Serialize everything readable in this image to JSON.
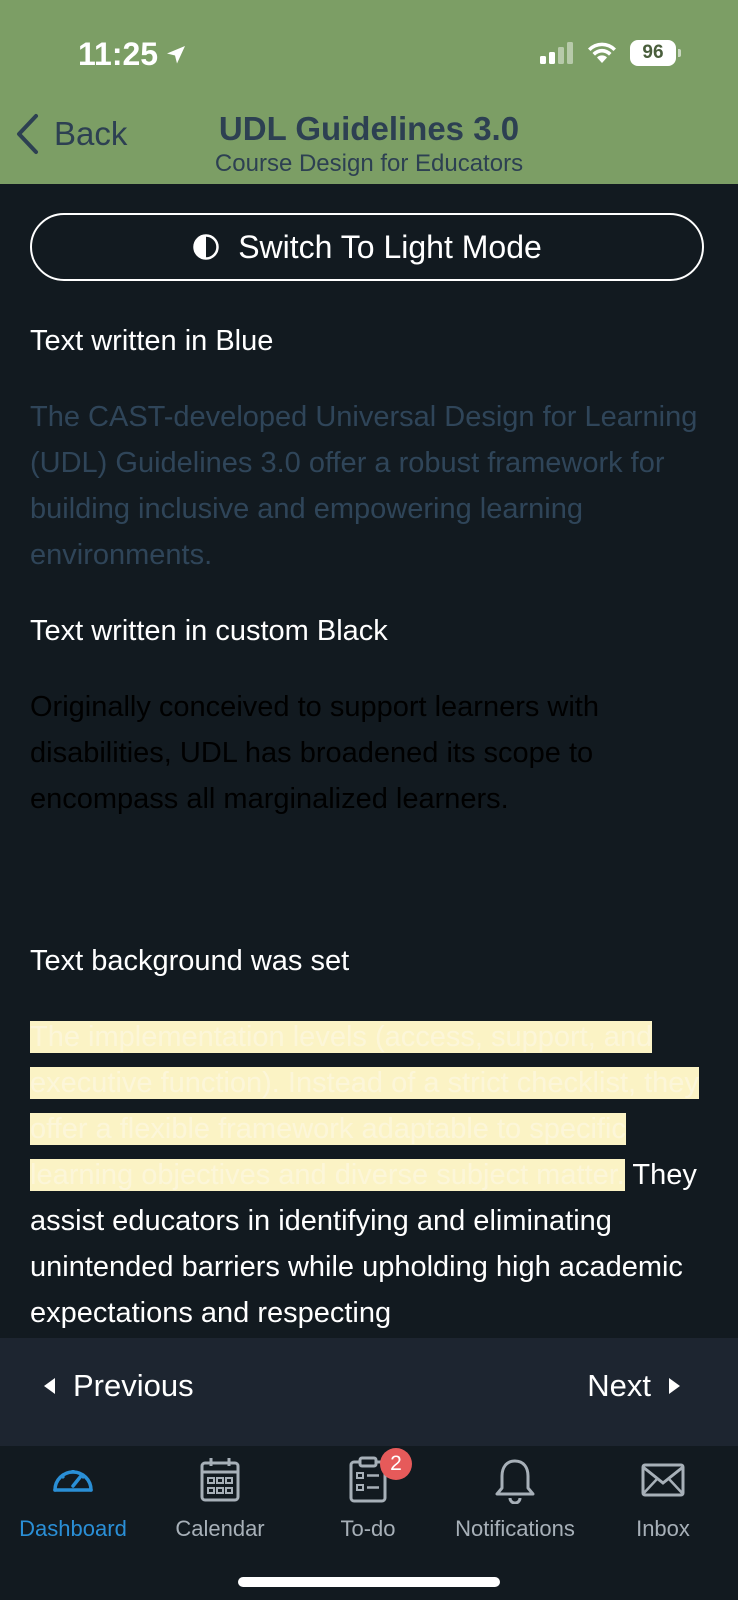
{
  "status_bar": {
    "time": "11:25",
    "battery": "96"
  },
  "header": {
    "back_label": "Back",
    "title": "UDL Guidelines 3.0",
    "subtitle": "Course Design for Educators"
  },
  "mode_toggle": {
    "label": "Switch To Light Mode"
  },
  "content": {
    "section1": {
      "heading": "Text written in Blue",
      "body": "The CAST-developed Universal Design for Learning (UDL) Guidelines 3.0 offer a robust framework for building inclusive and empowering learning environments."
    },
    "section2": {
      "heading": "Text written in custom Black",
      "body": "Originally conceived to support learners with disabilities, UDL has broadened its scope to encompass all marginalized learners."
    },
    "section3": {
      "heading": "Text background was set",
      "highlighted": "The implementation levels (access, support, and executive function). Instead of a strict checklist, they offer a flexible framework adaptable to specific learning objectives and diverse subject matter.",
      "plain": " They assist educators in identifying and eliminating unintended barriers while upholding high academic expectations and respecting"
    }
  },
  "pager": {
    "previous_label": "Previous",
    "next_label": "Next"
  },
  "tabs": [
    {
      "label": "Dashboard",
      "icon": "dashboard-gauge-icon",
      "active": true
    },
    {
      "label": "Calendar",
      "icon": "calendar-icon"
    },
    {
      "label": "To-do",
      "icon": "clipboard-icon",
      "badge": "2"
    },
    {
      "label": "Notifications",
      "icon": "bell-icon"
    },
    {
      "label": "Inbox",
      "icon": "envelope-icon"
    }
  ],
  "colors": {
    "header_bg": "#7c9e65",
    "header_text": "#2d4052",
    "page_bg": "#121a20",
    "blue_text": "#2f4559",
    "highlight_bg": "#fbf3c5",
    "active_tab": "#2a8fd6",
    "badge": "#e65a5a"
  }
}
